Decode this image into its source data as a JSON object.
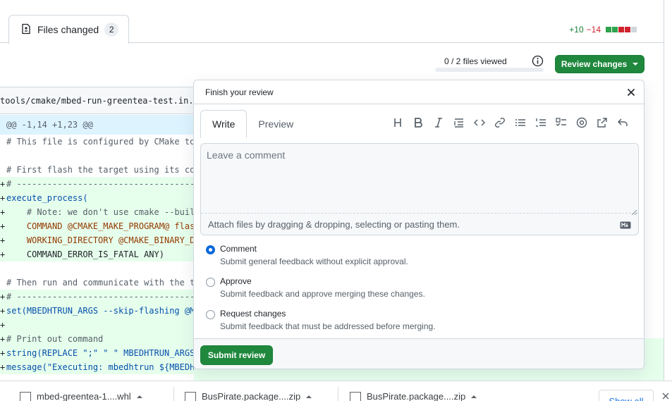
{
  "tabs": {
    "files_changed_label": "Files changed",
    "files_changed_count": "2"
  },
  "diffstat": {
    "additions": "+10",
    "deletions": "−14",
    "colors": [
      "#2da44e",
      "#2da44e",
      "#cf222e",
      "#cf222e",
      "#d0d7de"
    ]
  },
  "toolbar": {
    "files_viewed": "0 / 2 files viewed",
    "review_button": "Review changes"
  },
  "file": {
    "path": "tools/cmake/mbed-run-greentea-test.in.cmake",
    "hunk": "@@ -1,14 +1,23 @@",
    "lines": [
      {
        "text": "# This file is configured by CMake to cr",
        "type": "context",
        "style": "cm"
      },
      {
        "text": "",
        "type": "context",
        "style": ""
      },
      {
        "text": "# First flash the target using its confi",
        "type": "context",
        "style": "cm"
      },
      {
        "text": "# ---------------------------------------",
        "type": "added",
        "style": "cm"
      },
      {
        "text": "execute_process(",
        "type": "added",
        "style": "fn"
      },
      {
        "text": "    # Note: we don't use cmake --build b",
        "type": "added",
        "style": "cm"
      },
      {
        "text": "    COMMAND @CMAKE_MAKE_PROGRAM@ flash-@",
        "type": "added",
        "style": "kw"
      },
      {
        "text": "    WORKING_DIRECTORY @CMAKE_BINARY_DIR@",
        "type": "added",
        "style": "kw"
      },
      {
        "text": "    COMMAND_ERROR_IS_FATAL ANY)",
        "type": "added",
        "style": ""
      },
      {
        "text": "",
        "type": "context",
        "style": ""
      },
      {
        "text": "# Then run and communicate with the test",
        "type": "context",
        "style": "cm"
      },
      {
        "text": "# ---------------------------------------",
        "type": "added",
        "style": "cm"
      },
      {
        "text": "set(MBEDHTRUN_ARGS --skip-flashing @MBED_",
        "type": "added",
        "style": "fn"
      },
      {
        "text": "",
        "type": "added",
        "style": ""
      },
      {
        "text": "# Print out command",
        "type": "added",
        "style": "cm"
      },
      {
        "text": "string(REPLACE \";\" \" \" MBEDHTRUN_ARGS_FO",
        "type": "added",
        "style": "fn"
      },
      {
        "text": "message(\"Executing: mbedhtrun ${MBEDHTRU",
        "type": "added",
        "style": "fn"
      }
    ]
  },
  "review": {
    "title": "Finish your review",
    "tab_write": "Write",
    "tab_preview": "Preview",
    "placeholder": "Leave a comment",
    "attach_text": "Attach files by dragging & dropping, selecting or pasting them.",
    "options": [
      {
        "title": "Comment",
        "desc": "Submit general feedback without explicit approval.",
        "checked": true
      },
      {
        "title": "Approve",
        "desc": "Submit feedback and approve merging these changes.",
        "checked": false
      },
      {
        "title": "Request changes",
        "desc": "Submit feedback that must be addressed before merging.",
        "checked": false
      }
    ],
    "submit": "Submit review"
  },
  "downloads": {
    "items": [
      "mbed-greentea-1....whl",
      "BusPirate.package....zip",
      "BusPirate.package....zip"
    ],
    "show_all": "Show all"
  },
  "colors": {
    "accent_green": "#1f883d",
    "link_blue": "#0969da"
  }
}
